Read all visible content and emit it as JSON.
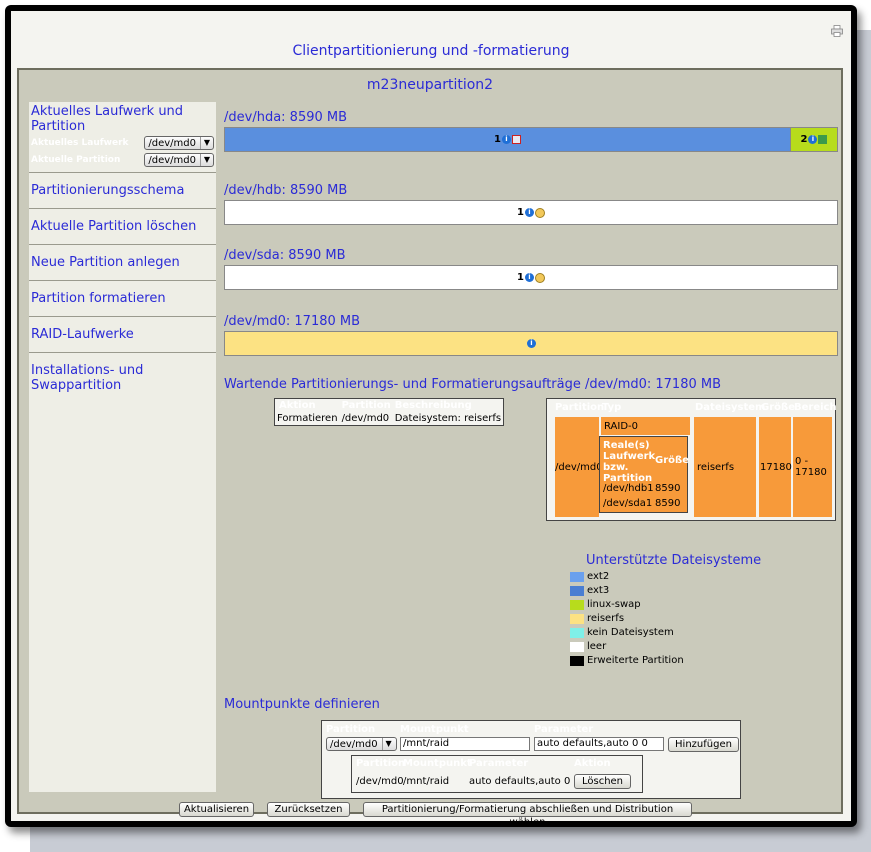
{
  "page": {
    "title": "Clientpartitionierung und -formatierung"
  },
  "panel": {
    "title": "m23neupartition2"
  },
  "sidebar": {
    "current_heading": "Aktuelles Laufwerk und Partition",
    "current_drive_label": "Aktuelles Laufwerk",
    "current_drive_value": "/dev/md0",
    "current_partition_label": "Aktuelle Partition",
    "current_partition_value": "/dev/md0",
    "items": [
      {
        "label": "Partitionierungsschema"
      },
      {
        "label": "Aktuelle Partition löschen"
      },
      {
        "label": "Neue Partition anlegen"
      },
      {
        "label": "Partition formatieren"
      },
      {
        "label": "RAID-Laufwerke"
      },
      {
        "label": "Installations- und Swappartition"
      }
    ]
  },
  "drives": [
    {
      "label": "/dev/hda: 8590 MB",
      "segments": [
        {
          "num": "1",
          "color": "#5a8fde",
          "fraction": 0.923
        },
        {
          "num": "2",
          "color": "#b7dc1c",
          "fraction": 0.077
        }
      ]
    },
    {
      "label": "/dev/hdb: 8590 MB",
      "segments": [
        {
          "num": "1",
          "color": "#ffffff",
          "fraction": 1.0
        }
      ]
    },
    {
      "label": "/dev/sda: 8590 MB",
      "segments": [
        {
          "num": "1",
          "color": "#ffffff",
          "fraction": 1.0
        }
      ]
    },
    {
      "label": "/dev/md0: 17180 MB",
      "segments": [
        {
          "num": "",
          "color": "#fce283",
          "fraction": 1.0
        }
      ]
    }
  ],
  "jobs": {
    "heading": "Wartende Partitionierungs- und Formatierungsaufträge  /dev/md0: 17180 MB",
    "headers": [
      "Aktion",
      "Partition",
      "Beschreibung"
    ],
    "rows": [
      [
        "Formatieren",
        "/dev/md0",
        "Dateisystem: reiserfs"
      ]
    ]
  },
  "raid": {
    "headers": [
      "Partition",
      "Typ",
      "Dateisystem",
      "Größe",
      "Bereich"
    ],
    "partition": "/dev/md0",
    "type": "RAID-0",
    "filesystem": "reiserfs",
    "size": "17180",
    "range": "0 - 17180",
    "inner_headers": [
      "Reale(s) Laufwerk bzw. Partition",
      "Größe"
    ],
    "inner_rows": [
      [
        "/dev/hdb1",
        "8590"
      ],
      [
        "/dev/sda1",
        "8590"
      ]
    ]
  },
  "legend": {
    "title": "Unterstützte Dateisysteme",
    "items": [
      {
        "label": "ext2",
        "color": "#6aa0ee"
      },
      {
        "label": "ext3",
        "color": "#4a7ed2"
      },
      {
        "label": "linux-swap",
        "color": "#b7dc1c"
      },
      {
        "label": "reiserfs",
        "color": "#fce283"
      },
      {
        "label": "kein Dateisystem",
        "color": "#7ff0e8"
      },
      {
        "label": "leer",
        "color": "#ffffff"
      },
      {
        "label": "Erweiterte Partition",
        "color": "#000000"
      }
    ]
  },
  "mount": {
    "heading": "Mountpunkte definieren",
    "headers": [
      "Partition",
      "Mountpunkt",
      "Parameter"
    ],
    "partition_value": "/dev/md0",
    "mountpoint_value": "/mnt/raid",
    "parameter_value": "auto defaults,auto 0 0",
    "add_button": "Hinzufügen",
    "list_headers": [
      "Partition",
      "Mountpunkt",
      "Parameter",
      "Aktion"
    ],
    "list_rows": [
      [
        "/dev/md0",
        "/mnt/raid",
        "auto defaults,auto 0 0"
      ]
    ],
    "delete_button": "Löschen"
  },
  "footer": {
    "refresh": "Aktualisieren",
    "reset": "Zurücksetzen",
    "finish": "Partitionierung/Formatierung abschließen und Distribution wählen"
  }
}
